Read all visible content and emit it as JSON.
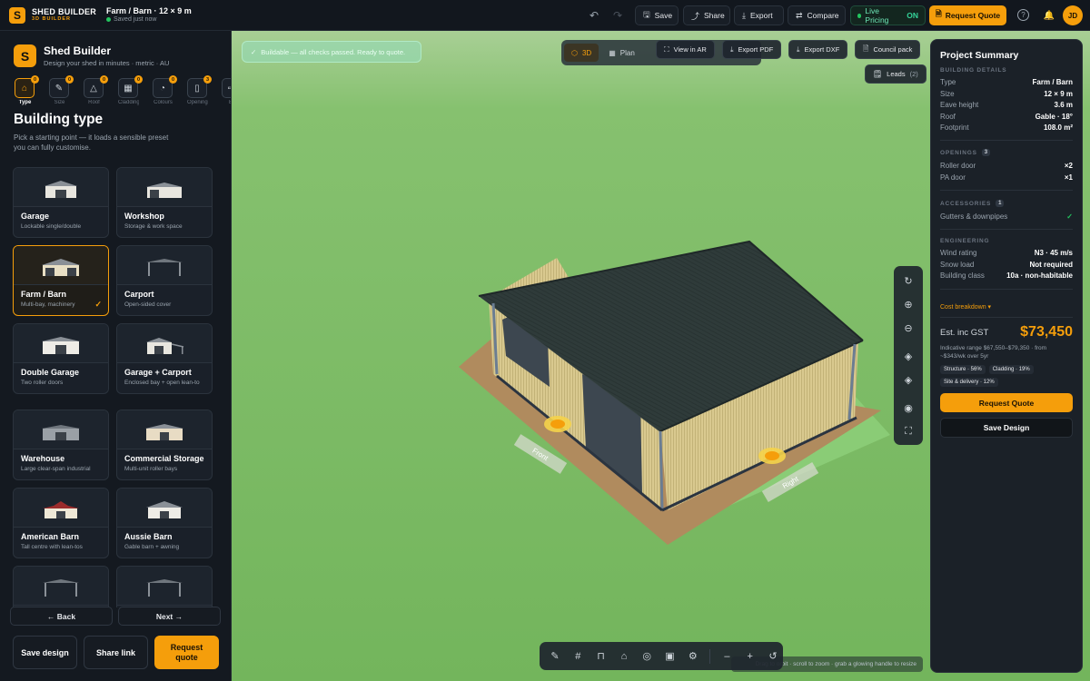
{
  "topbar": {
    "brand_logo": "S",
    "brand_name": "SHED BUILDER",
    "brand_sub": "3D BUILDER",
    "doc_title": "Farm / Barn · 12 × 9 m",
    "doc_status": "Saved just now",
    "undo_icon": "↶",
    "redo_icon": "↷",
    "save_icon": "🖫",
    "save_label": "Save",
    "share_icon": "⤴",
    "share_label": "Share",
    "export_icon": "⤓",
    "export_label": "Export",
    "compare_icon": "⇄",
    "compare_label": "Compare",
    "live_label": "Live Pricing",
    "live_state": "ON",
    "quote_icon": "🗎",
    "quote_label": "Request Quote",
    "help_icon": "?",
    "bell_icon": "🔔",
    "avatar": "JD"
  },
  "sidebar": {
    "logo": "S",
    "title": "Shed Builder",
    "subtitle": "Design your shed in minutes · metric · AU",
    "steps": [
      {
        "label": "Type",
        "badge": "0",
        "icon": "⌂"
      },
      {
        "label": "Size",
        "badge": "0",
        "icon": "✎"
      },
      {
        "label": "Roof",
        "badge": "0",
        "icon": "△"
      },
      {
        "label": "Cladding",
        "badge": "0",
        "icon": "▦"
      },
      {
        "label": "Colours",
        "badge": "0",
        "icon": "◔"
      },
      {
        "label": "Openings",
        "badge": "3",
        "icon": "▯"
      },
      {
        "label": "Ex",
        "badge": "",
        "icon": "⇨"
      }
    ],
    "section_title": "Building type",
    "section_desc": "Pick a starting point — it loads a sensible preset you can fully customise.",
    "cards": [
      {
        "name": "Garage",
        "desc": "Lockable single/double"
      },
      {
        "name": "Workshop",
        "desc": "Storage & work space"
      },
      {
        "name": "Farm / Barn",
        "desc": "Multi-bay, machinery"
      },
      {
        "name": "Carport",
        "desc": "Open-sided cover"
      },
      {
        "name": "Double Garage",
        "desc": "Two roller doors"
      },
      {
        "name": "Garage + Carport",
        "desc": "Enclosed bay + open lean-to"
      },
      {
        "name": "Warehouse",
        "desc": "Large clear-span industrial"
      },
      {
        "name": "Commercial Storage",
        "desc": "Multi-unit roller bays"
      },
      {
        "name": "American Barn",
        "desc": "Tall centre with lean-tos"
      },
      {
        "name": "Aussie Barn",
        "desc": "Gable barn + awning"
      }
    ],
    "selected_check": "✓",
    "back_label": "← Back",
    "next_label": "Next →",
    "save_design_label": "Save design",
    "share_link_label": "Share link",
    "request_quote_label": "Request quote"
  },
  "viewport": {
    "toast_icon": "✓",
    "toast_text": "Buildable — all checks passed. Ready to quote.",
    "view_3d": "3D",
    "view_plan": "Plan",
    "view_ar": "View in AR",
    "export_pdf": "Export PDF",
    "export_dxf": "Export DXF",
    "council_pack": "Council pack",
    "leads_label": "Leads",
    "leads_count": "(2)",
    "label_front": "Front",
    "label_right": "Right",
    "hint": "Drag to orbit · scroll to zoom · grab a glowing handle to resize",
    "tools_v": [
      "↻",
      "⊕",
      "⊖",
      "◈",
      "◈",
      "◉",
      "⛶"
    ],
    "tools_h": [
      "✎",
      "#",
      "⊓",
      "⌂",
      "◎",
      "▣",
      "⚙"
    ],
    "zoom_out": "–",
    "zoom_in": "+",
    "reset": "↺"
  },
  "summary": {
    "title": "Project Summary",
    "building_details_label": "BUILDING DETAILS",
    "details": [
      {
        "k": "Type",
        "v": "Farm / Barn"
      },
      {
        "k": "Size",
        "v": "12 × 9 m"
      },
      {
        "k": "Eave height",
        "v": "3.6 m"
      },
      {
        "k": "Roof",
        "v": "Gable · 18°"
      },
      {
        "k": "Footprint",
        "v": "108.0 m²"
      }
    ],
    "openings_label": "OPENINGS",
    "openings_count": "3",
    "openings": [
      {
        "k": "Roller door",
        "v": "×2"
      },
      {
        "k": "PA door",
        "v": "×1"
      }
    ],
    "accessories_label": "ACCESSORIES",
    "accessories_count": "1",
    "accessories": [
      {
        "k": "Gutters & downpipes",
        "v": "✓"
      }
    ],
    "engineering_label": "ENGINEERING",
    "engineering": [
      {
        "k": "Wind rating",
        "v": "N3 · 45 m/s"
      },
      {
        "k": "Snow load",
        "v": "Not required"
      },
      {
        "k": "Building class",
        "v": "10a · non-habitable"
      }
    ],
    "cost_breakdown": "Cost breakdown ▾",
    "est_label": "Est. inc GST",
    "est_value": "$73,450",
    "est_range": "Indicative range $67,550–$79,350 · from ~$343/wk over 5yr",
    "chips": [
      "Structure · 56%",
      "Cladding · 19%",
      "Site & delivery · 12%"
    ],
    "request_quote": "Request Quote",
    "save_design": "Save Design"
  },
  "colors": {
    "accent": "#f59e0b",
    "success": "#22c55e",
    "roof": "#2f3b3a",
    "wall": "#d9c98f",
    "ground": "#73b55c",
    "slab": "#b08b5e"
  }
}
